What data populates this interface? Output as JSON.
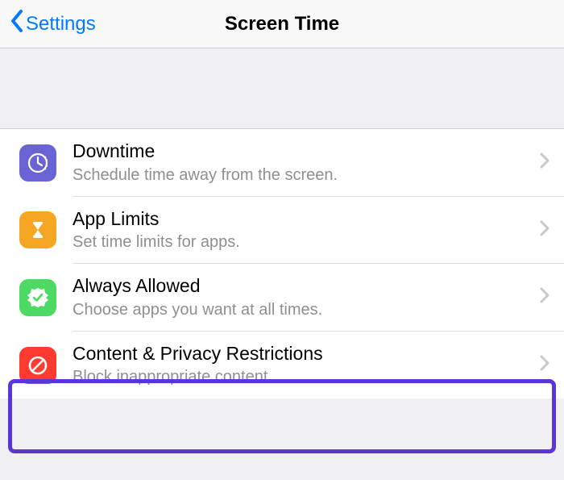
{
  "nav": {
    "back_label": "Settings",
    "title": "Screen Time"
  },
  "rows": [
    {
      "title": "Downtime",
      "subtitle": "Schedule time away from the screen."
    },
    {
      "title": "App Limits",
      "subtitle": "Set time limits for apps."
    },
    {
      "title": "Always Allowed",
      "subtitle": "Choose apps you want at all times."
    },
    {
      "title": "Content & Privacy Restrictions",
      "subtitle": "Block inappropriate content."
    }
  ]
}
